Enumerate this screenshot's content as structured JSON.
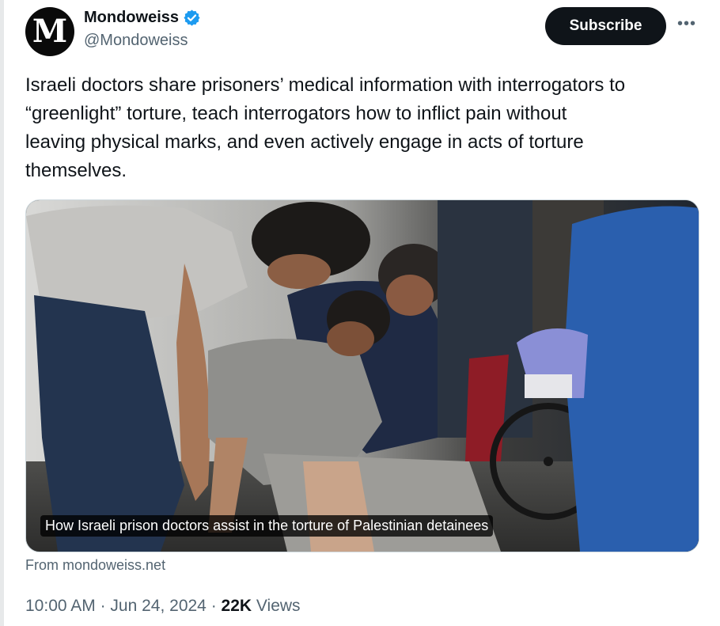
{
  "author": {
    "display_name": "Mondoweiss",
    "handle": "@Mondoweiss",
    "avatar_letter": "M",
    "verified": true,
    "verified_color": "#1d9bf0"
  },
  "actions": {
    "subscribe_label": "Subscribe",
    "more_icon": "more-horizontal-icon"
  },
  "tweet": {
    "text": "Israeli doctors share prisoners’ medical information with interrogators to\n“greenlight” torture, teach interrogators how to inflict pain without\nleaving physical marks, and even actively engage in acts of torture\nthemselves."
  },
  "card": {
    "caption": "How Israeli prison doctors assist in the torture of Palestinian detainees",
    "source": "From mondoweiss.net"
  },
  "meta": {
    "time": "10:00 AM",
    "separator": "·",
    "date": "Jun 24, 2024",
    "views_count": "22K",
    "views_label": "Views"
  },
  "colors": {
    "text_primary": "#0f1419",
    "text_secondary": "#536471",
    "button_bg": "#0f1419",
    "accent": "#1d9bf0"
  }
}
